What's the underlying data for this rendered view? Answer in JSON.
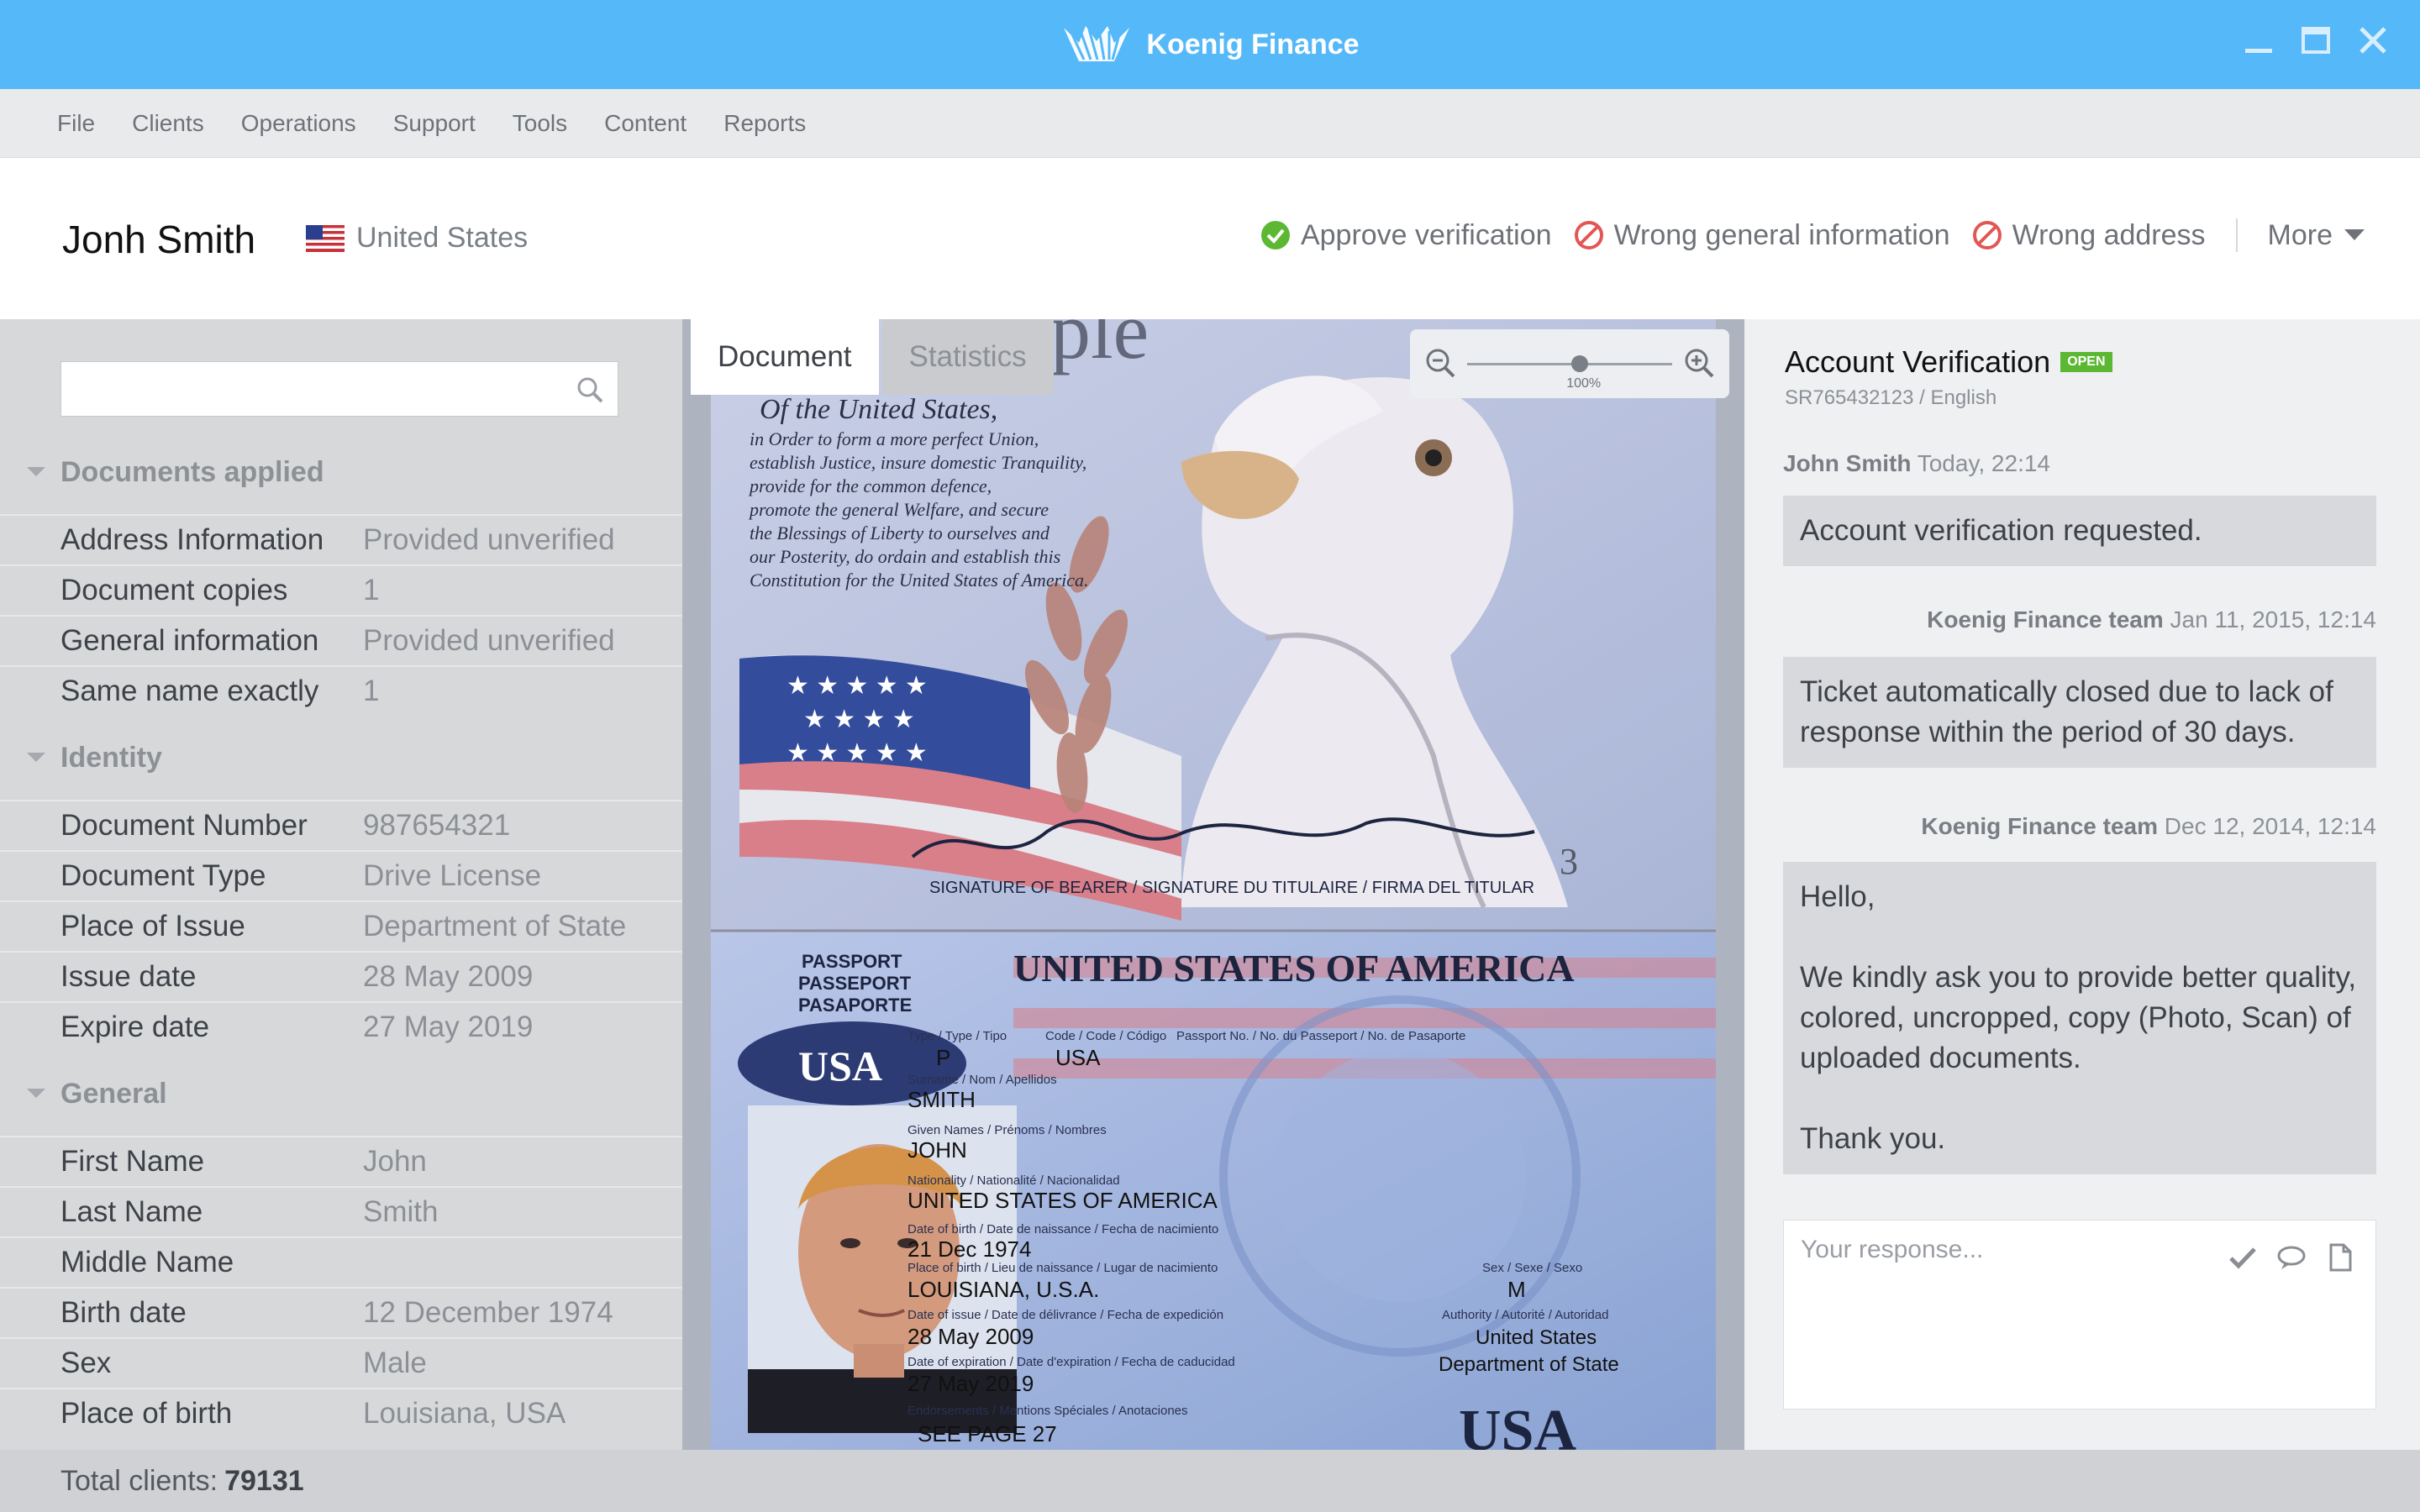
{
  "app": {
    "title": "Koenig Finance"
  },
  "menu": [
    "File",
    "Clients",
    "Operations",
    "Support",
    "Tools",
    "Content",
    "Reports"
  ],
  "header": {
    "client_name": "Jonh Smith",
    "country": "United States",
    "actions": {
      "approve": "Approve verification",
      "wrong_general": "Wrong general information",
      "wrong_address": "Wrong address",
      "more": "More"
    }
  },
  "sidebar": {
    "search_placeholder": "",
    "sections": [
      {
        "title": "Documents applied",
        "rows": [
          {
            "k": "Address Information",
            "v": "Provided unverified"
          },
          {
            "k": "Document copies",
            "v": "1"
          },
          {
            "k": "General information",
            "v": "Provided unverified"
          },
          {
            "k": "Same name exactly",
            "v": "1"
          }
        ]
      },
      {
        "title": "Identity",
        "rows": [
          {
            "k": "Document Number",
            "v": "987654321"
          },
          {
            "k": "Document Type",
            "v": "Drive License"
          },
          {
            "k": "Place of Issue",
            "v": "Department of State"
          },
          {
            "k": "Issue date",
            "v": "28 May 2009"
          },
          {
            "k": "Expire date",
            "v": "27 May 2019"
          }
        ]
      },
      {
        "title": "General",
        "rows": [
          {
            "k": "First Name",
            "v": "John"
          },
          {
            "k": "Last Name",
            "v": "Smith"
          },
          {
            "k": "Middle Name",
            "v": ""
          },
          {
            "k": "Birth date",
            "v": "12 December 1974"
          },
          {
            "k": "Sex",
            "v": "Male"
          },
          {
            "k": "Place of birth",
            "v": "Louisiana, USA"
          }
        ]
      }
    ]
  },
  "viewer": {
    "tabs": [
      "Document",
      "Statistics"
    ],
    "zoom_label": "100%",
    "zoom_level": 0.55,
    "passport": {
      "preamble": [
        "Of the United States,",
        "in Order to form a more perfect Union,",
        "establish Justice, insure domestic Tranquility,",
        "provide for the common defence,",
        "promote the general Welfare, and secure",
        "the Blessings of Liberty to ourselves and",
        "our Posterity, do ordain and establish this",
        "Constitution for the United States of America."
      ],
      "signature_line": "SIGNATURE OF BEARER / SIGNATURE DU TITULAIRE / FIRMA DEL TITULAR",
      "page_num": "3",
      "passport_words": [
        "PASSPORT",
        "PASSEPORT",
        "PASAPORTE"
      ],
      "country_title": "UNITED STATES OF AMERICA",
      "usa": "USA",
      "type_label": "Type / Type / Tipo",
      "code_label": "Code / Code / Código",
      "passno_label": "Passport No. / No. du Passeport / No. de Pasaporte",
      "type": "P",
      "code": "USA",
      "surname_label": "Surname / Nom / Apellidos",
      "surname": "SMITH",
      "given_label": "Given Names / Prénoms / Nombres",
      "given": "JOHN",
      "nationality_label": "Nationality / Nationalité / Nacionalidad",
      "nationality": "UNITED STATES OF AMERICA",
      "dob_label": "Date of birth / Date de naissance / Fecha de nacimiento",
      "dob": "21 Dec 1974",
      "pob_label": "Place of birth / Lieu de naissance / Lugar de nacimiento",
      "pob": "LOUISIANA, U.S.A.",
      "sex_label": "Sex / Sexe / Sexo",
      "sex": "M",
      "issue_label": "Date of issue / Date de délivrance / Fecha de expedición",
      "issue": "28 May 2009",
      "authority_label": "Authority / Autorité / Autoridad",
      "authority_1": "United States",
      "authority_2": "Department of State",
      "expiry_label": "Date of expiration / Date d'expiration / Fecha de caducidad",
      "expiry": "27 May 2019",
      "endorse_label": "Endorsements / Mentions Spéciales / Anotaciones",
      "endorse": "SEE PAGE 27",
      "people": "People"
    }
  },
  "ticket": {
    "title": "Account Verification",
    "status": "OPEN",
    "sub": "SR765432123 / English",
    "messages": [
      {
        "author": "John Smith",
        "time": "Today, 22:14",
        "text": "Account verification requested."
      },
      {
        "author": "Koenig Finance team",
        "time": "Jan 11, 2015, 12:14",
        "text": "Ticket automatically closed due to lack of response within the period of 30 days."
      },
      {
        "author": "Koenig Finance team",
        "time": "Dec 12, 2014, 12:14",
        "lines": [
          "Hello,",
          "",
          "We kindly ask you to provide better quality, colored, uncropped, copy (Photo, Scan) of uploaded documents.",
          "",
          "Thank you."
        ]
      }
    ],
    "reply_placeholder": "Your response..."
  },
  "status": {
    "label": "Total clients:",
    "count": "79131"
  },
  "colors": {
    "accent": "#55b8f8",
    "approve": "#5cb832",
    "reject": "#e35656",
    "badge": "#5cb832"
  }
}
